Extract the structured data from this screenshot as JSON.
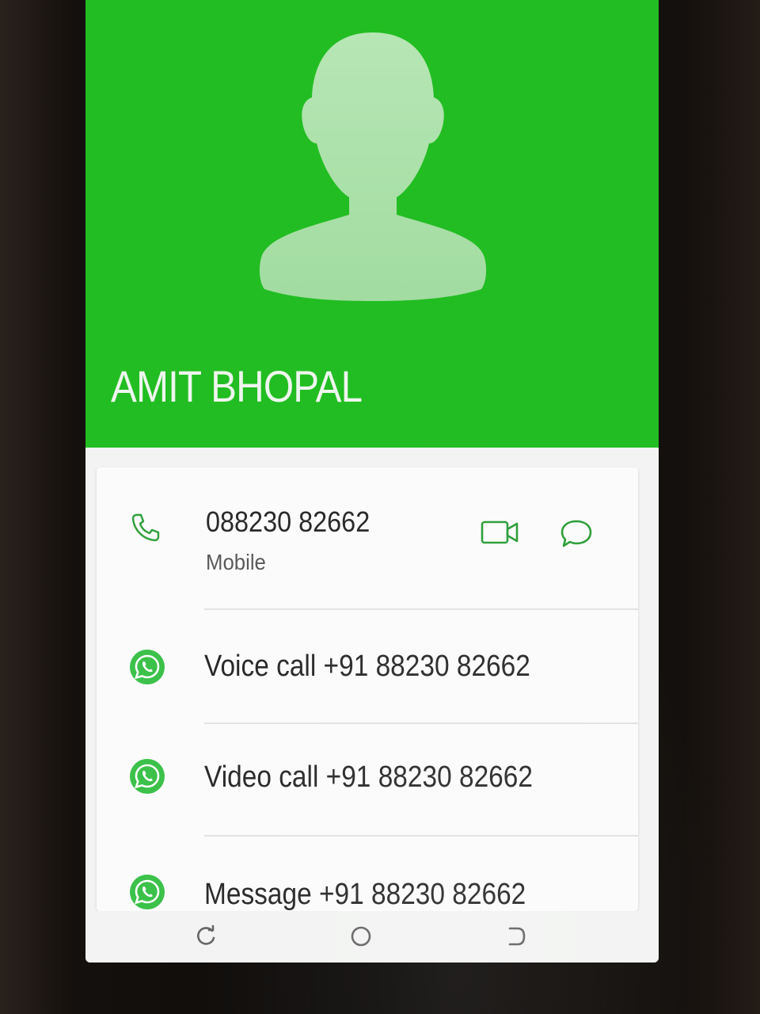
{
  "contact": {
    "name": "AMIT BHOPAL",
    "header_color": "#22bd22"
  },
  "phone_entry": {
    "number": "088230 82662",
    "type": "Mobile",
    "icons": [
      "phone-icon",
      "video-call-icon",
      "message-bubble-icon"
    ]
  },
  "whatsapp_actions": [
    {
      "label": "Voice call +91 88230 82662",
      "icon": "whatsapp-icon"
    },
    {
      "label": "Video call +91 88230 82662",
      "icon": "whatsapp-icon"
    },
    {
      "label": "Message +91 88230 82662",
      "icon": "whatsapp-icon"
    }
  ],
  "navbar": {
    "buttons": [
      "recents-icon",
      "home-icon",
      "back-icon"
    ]
  },
  "colors": {
    "accent_green": "#22bd22",
    "icon_green": "#2e9e3a",
    "whatsapp_green": "#3cc14a"
  }
}
